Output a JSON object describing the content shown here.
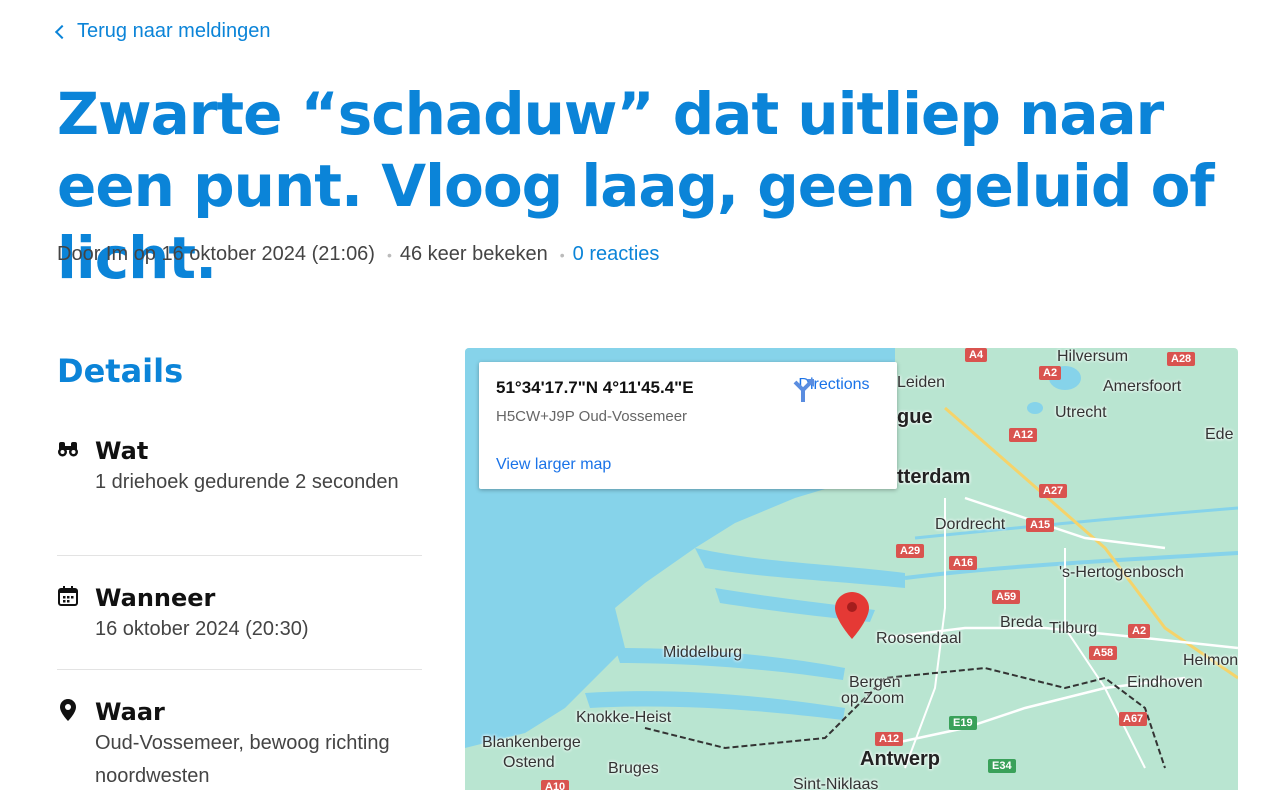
{
  "nav": {
    "back_label": "Terug naar meldingen"
  },
  "report": {
    "title": "Zwarte “schaduw” dat uitliep naar een punt. Vloog laag, geen geluid of licht.",
    "meta_author_date": "Door Im op 16 oktober 2024 (21:06)",
    "meta_views": "46 keer bekeken",
    "meta_reactions": "0 reacties"
  },
  "details": {
    "heading": "Details",
    "items": [
      {
        "icon": "binoculars-icon",
        "label": "Wat",
        "value": "1 driehoek gedurende 2 seconden"
      },
      {
        "icon": "calendar-icon",
        "label": "Wanneer",
        "value": "16 oktober 2024 (20:30)"
      },
      {
        "icon": "location-pin-icon",
        "label": "Waar",
        "value": "Oud-Vossemeer, bewoog richting noordwesten"
      }
    ]
  },
  "map": {
    "coords": "51°34'17.7\"N 4°11'45.4\"E",
    "plus_code": "H5CW+J9P Oud-Vossemeer",
    "directions_label": "Directions",
    "view_larger_label": "View larger map",
    "places": [
      "Leiden",
      "gue",
      "Hilversum",
      "Amersfoort",
      "Utrecht",
      "Ede",
      "tterdam",
      "Dordrecht",
      "'s-Hertogenbosch",
      "Breda",
      "Tilburg",
      "Roosendaal",
      "Middelburg",
      "Bergen",
      "op Zoom",
      "Eindhoven",
      "Helmon",
      "Knokke-Heist",
      "Blankenberge",
      "Ostend",
      "Bruges",
      "Antwerp",
      "Sint-Niklaas"
    ],
    "roads": [
      "A4",
      "A2",
      "A28",
      "A12",
      "A27",
      "A15",
      "A29",
      "A16",
      "A59",
      "A2",
      "A58",
      "A67",
      "E19",
      "A12",
      "E34",
      "A10"
    ],
    "colors": {
      "water": "#86d3ea",
      "land": "#b9e5d1",
      "marker": "#e53935",
      "accent": "#0b84d8",
      "link": "#1a73e8"
    }
  }
}
